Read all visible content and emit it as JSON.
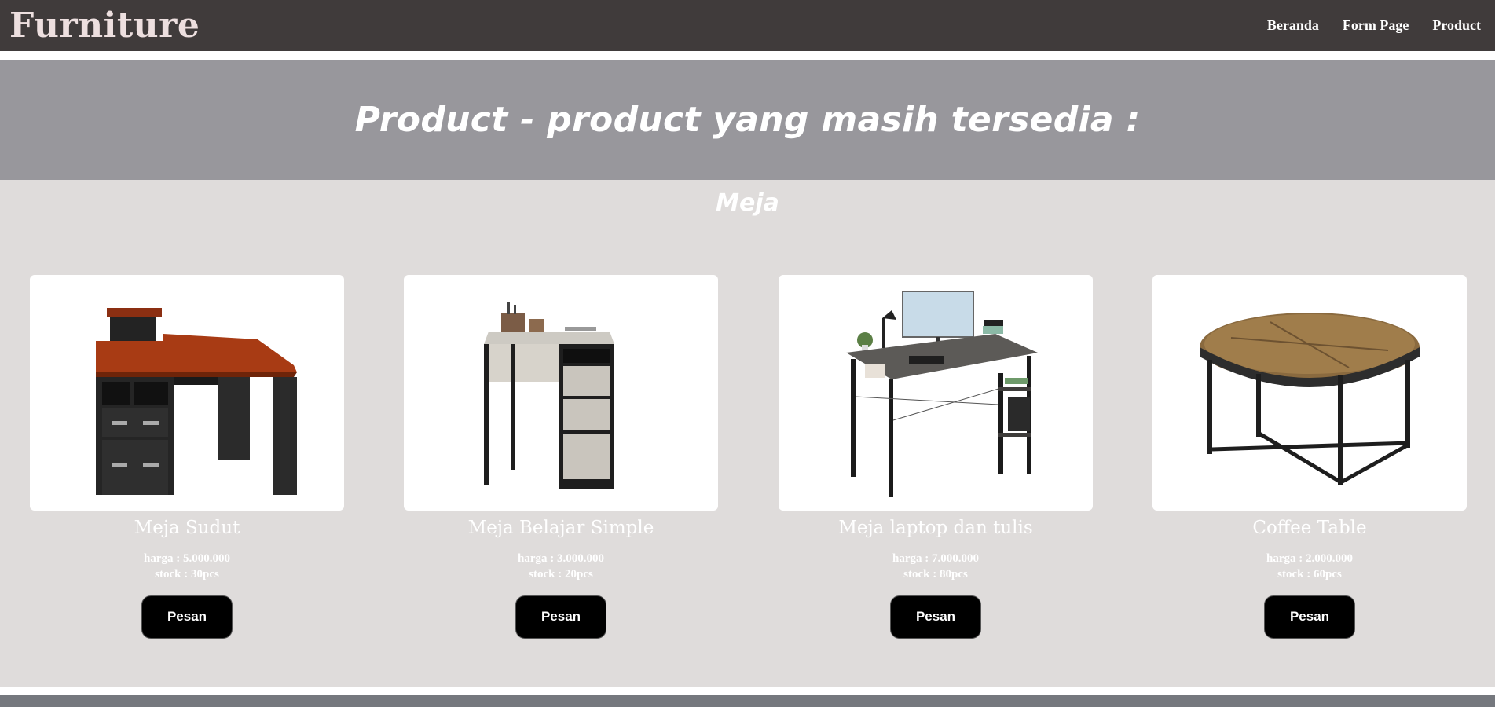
{
  "header": {
    "brand": "Furniture",
    "nav": [
      {
        "label": "Beranda"
      },
      {
        "label": "Form Page"
      },
      {
        "label": "Product"
      }
    ]
  },
  "hero": {
    "title": "Product - product yang masih tersedia :"
  },
  "catalog": {
    "category": "Meja",
    "products": [
      {
        "name": "Meja Sudut",
        "price": "harga : 5.000.000",
        "stock": "stock : 30pcs",
        "button": "Pesan",
        "image": "corner-desk-image"
      },
      {
        "name": "Meja Belajar Simple",
        "price": "harga : 3.000.000",
        "stock": "stock : 20pcs",
        "button": "Pesan",
        "image": "study-desk-image"
      },
      {
        "name": "Meja laptop dan tulis",
        "price": "harga : 7.000.000",
        "stock": "stock : 80pcs",
        "button": "Pesan",
        "image": "laptop-desk-image"
      },
      {
        "name": "Coffee Table",
        "price": "harga : 2.000.000",
        "stock": "stock : 60pcs",
        "button": "Pesan",
        "image": "coffee-table-image"
      }
    ]
  },
  "colors": {
    "header_bg": "#403b3b",
    "hero_bg": "#98979c",
    "catalog_bg": "#dfdcdb",
    "footer_bg": "#75787e",
    "button_bg": "#000000"
  }
}
